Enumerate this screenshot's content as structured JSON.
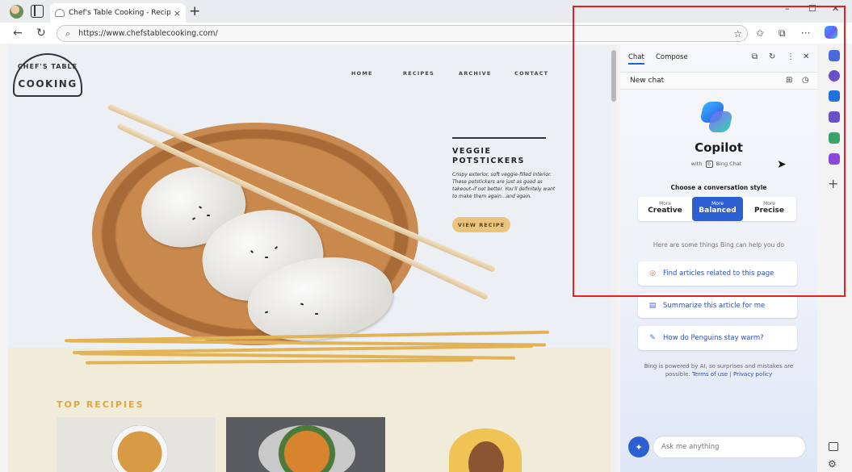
{
  "browser": {
    "tab_title": "Chef's Table Cooking - Recipe ideas",
    "tab_close": "×",
    "new_tab": "+",
    "url": "https://www.chefstablecooking.com/",
    "window": {
      "minimize": "–",
      "maximize": "☐",
      "close": "✕"
    },
    "nav": {
      "back": "←",
      "reload": "↻",
      "search_glyph": "⌕",
      "favorite_glyph": "☆",
      "favorites_glyph": "✩",
      "collections_glyph": "⧉",
      "more_glyph": "···"
    }
  },
  "site": {
    "logo_top": "CHEF'S TABLE",
    "logo_main": "COOKING",
    "nav": [
      "HOME",
      "RECIPES",
      "ARCHIVE",
      "CONTACT"
    ],
    "featured": {
      "title": "VEGGIE POTSTICKERS",
      "description": "Crispy exterior, soft veggie-filled interior. These potstickers are just as good as takeout–if not better. You'll definitely want to make them again...and again.",
      "button": "VIEW RECIPE"
    },
    "section_title": "TOP RECIPIES"
  },
  "copilot": {
    "tabs": [
      "Chat",
      "Compose"
    ],
    "header_icons": {
      "open": "⧉",
      "refresh": "↻",
      "more": "⋮",
      "close": "✕"
    },
    "new_chat": "New chat",
    "new_chat_icons": {
      "grid": "⊞",
      "history": "◷"
    },
    "title": "Copilot",
    "subtitle_with": "with",
    "subtitle_badge": "b",
    "subtitle_brand": "Bing Chat",
    "choose_style": "Choose a conversation style",
    "styles": [
      {
        "more": "More",
        "label": "Creative",
        "active": false
      },
      {
        "more": "More",
        "label": "Balanced",
        "active": true
      },
      {
        "more": "More",
        "label": "Precise",
        "active": false
      }
    ],
    "help_text": "Here are some things Bing can help you do",
    "suggestions": [
      {
        "icon": "target-icon",
        "glyph": "◎",
        "text": "Find articles related to this page",
        "color": "#e07a3c"
      },
      {
        "icon": "document-icon",
        "glyph": "▤",
        "text": "Summarize this article for me",
        "color": "#4a6ad8"
      },
      {
        "icon": "chat-bubble-icon",
        "glyph": "✎",
        "text": "How do Penguins stay warm?",
        "color": "#4a6ad8"
      }
    ],
    "disclaimer_main": "Bing is powered by AI, so surprises and mistakes are possible.",
    "terms": "Terms of use",
    "separator": "|",
    "privacy": "Privacy policy",
    "input_placeholder": "Ask me anything"
  },
  "strip": {
    "icons": [
      {
        "name": "tag-icon",
        "color": "#4a6ad8"
      },
      {
        "name": "office-icon",
        "color": "#6a4fc9"
      },
      {
        "name": "outlook-icon",
        "color": "#1e72d9"
      },
      {
        "name": "tools-icon",
        "color": "#6a4fc9"
      },
      {
        "name": "shopping-icon",
        "color": "#3aa36a"
      },
      {
        "name": "games-icon",
        "color": "#8a48d6"
      }
    ],
    "add": "+"
  },
  "colors": {
    "accent": "#2c5fcf",
    "highlight": "#e62020",
    "button": "#eac47d"
  }
}
